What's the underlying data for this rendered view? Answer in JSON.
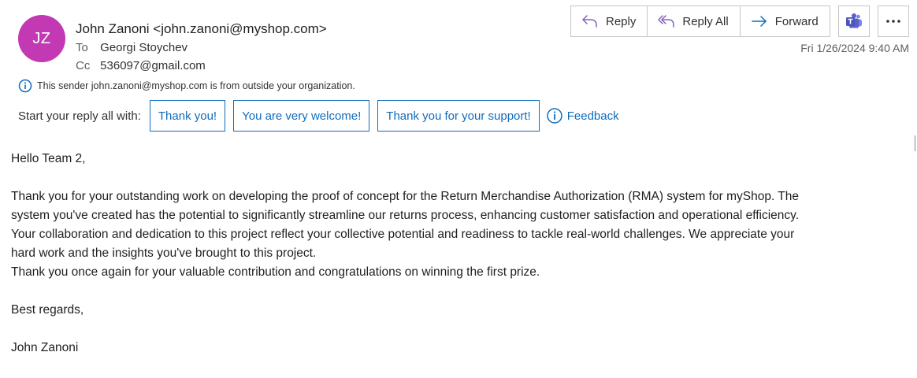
{
  "sender": {
    "initials": "JZ",
    "display": "John Zanoni <john.zanoni@myshop.com>",
    "avatar_color": "#c239b3"
  },
  "recipients": {
    "to_label": "To",
    "to": "Georgi Stoychev",
    "cc_label": "Cc",
    "cc": "536097@gmail.com"
  },
  "external_notice": "This sender john.zanoni@myshop.com is from outside your organization.",
  "toolbar": {
    "reply_label": "Reply",
    "reply_all_label": "Reply All",
    "forward_label": "Forward"
  },
  "date": "Fri 1/26/2024 9:40 AM",
  "suggested_replies": {
    "prompt": "Start your reply all with:",
    "items": [
      "Thank you!",
      "You are very welcome!",
      "Thank you for your support!"
    ],
    "feedback_label": "Feedback"
  },
  "body": {
    "greeting": "Hello Team 2,",
    "paragraph_lines": [
      "Thank you for your outstanding work on developing the proof of concept for the Return Merchandise Authorization (RMA) system for myShop. The",
      "system you've created has the potential to significantly streamline our returns process, enhancing customer satisfaction and operational efficiency.",
      "Your collaboration and dedication to this project reflect your collective potential and readiness to tackle real-world challenges. We appreciate your",
      "hard work and the insights you've brought to this project.",
      "Thank you once again for your valuable contribution and congratulations on winning the first prize."
    ],
    "closing": "Best regards,",
    "signature": "John Zanoni"
  },
  "colors": {
    "accent": "#0f6cbd",
    "teams": "#5b5fc7"
  }
}
